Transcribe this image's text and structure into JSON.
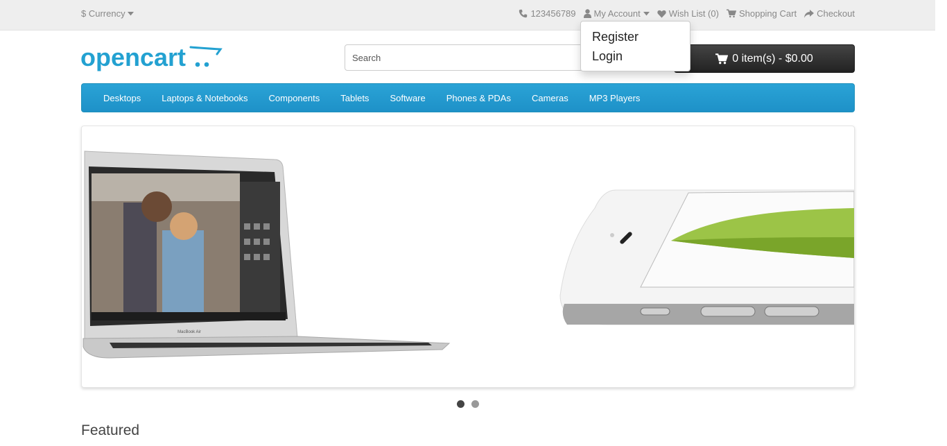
{
  "topbar": {
    "currency_label": "$ Currency",
    "links": {
      "phone": "123456789",
      "my_account": "My Account",
      "wishlist": "Wish List (0)",
      "shopping_cart": "Shopping Cart",
      "checkout": "Checkout"
    }
  },
  "account_dropdown": {
    "items": [
      "Register",
      "Login"
    ]
  },
  "header": {
    "logo_text": "opencart",
    "search_placeholder": "Search",
    "cart_label": "0 item(s) - $0.00"
  },
  "menu": {
    "items": [
      "Desktops",
      "Laptops & Notebooks",
      "Components",
      "Tablets",
      "Software",
      "Phones & PDAs",
      "Cameras",
      "MP3 Players"
    ]
  },
  "slideshow": {
    "slide_count": 2,
    "active_index": 0,
    "laptop_caption": "MacBook Air"
  },
  "featured_heading": "Featured",
  "colors": {
    "menu_blue": "#229ac8",
    "logo_blue": "#23a1d1",
    "cart_dark": "#2d2d2d"
  }
}
